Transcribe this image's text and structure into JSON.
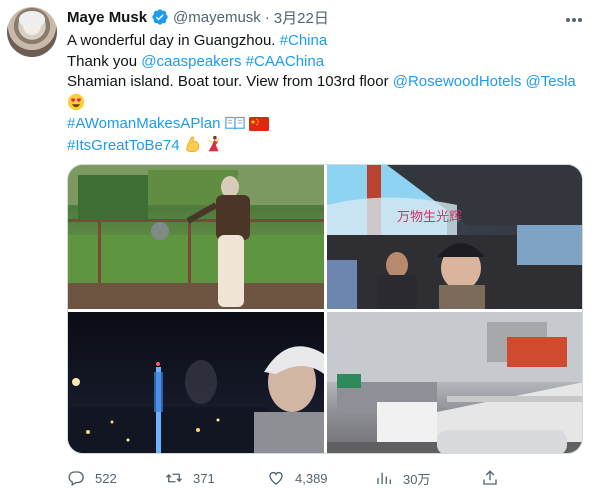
{
  "author": {
    "name": "Maye Musk",
    "handle": "@mayemusk",
    "separator": "·",
    "date": "3月22日"
  },
  "body": {
    "line1_text": "A wonderful day in Guangzhou. ",
    "line1_tag": "#China",
    "line2_text": "Thank you ",
    "line2_mention": "@caaspeakers",
    "line2_tag": "#CAAChina",
    "line3_text": "Shamian island. Boat tour. View from 103rd floor ",
    "line3_mention1": "@RosewoodHotels",
    "line3_mention2": "@Tesla",
    "line5_tag": "#AWomanMakesAPlan",
    "line6_tag": "#ItsGreatToBe74"
  },
  "stats": {
    "replies": "522",
    "retweets": "371",
    "likes": "4,389",
    "views": "30万"
  },
  "colors": {
    "accent": "#1d9bf0",
    "text": "#0f1419",
    "muted": "#536471"
  },
  "icons": [
    "verified-badge-icon",
    "more-icon",
    "heart-eyes-emoji",
    "book-emoji",
    "china-flag-emoji",
    "flexed-biceps-emoji",
    "dancer-emoji",
    "reply-icon",
    "retweet-icon",
    "like-icon",
    "views-icon",
    "share-icon"
  ]
}
